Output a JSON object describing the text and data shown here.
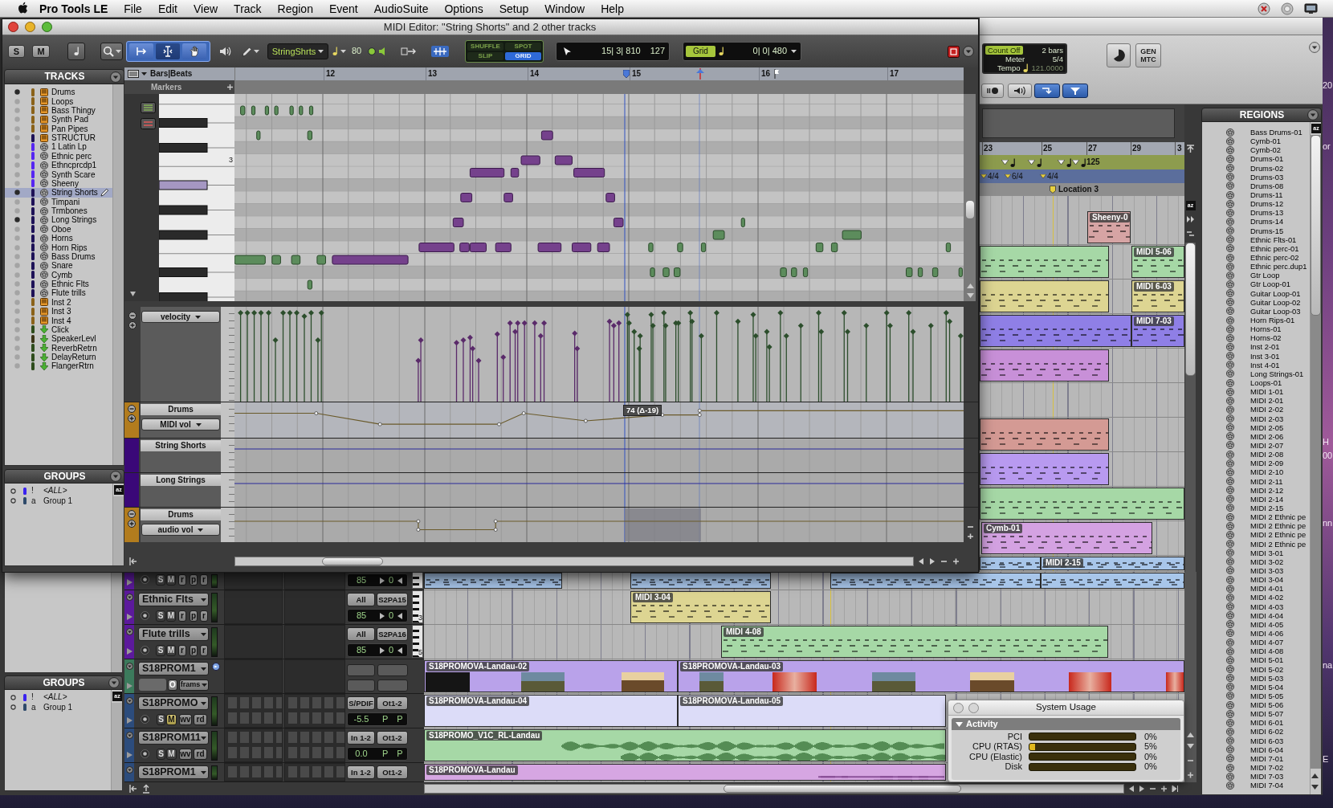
{
  "menu_bar": {
    "app": "Pro Tools LE",
    "items": [
      "File",
      "Edit",
      "View",
      "Track",
      "Region",
      "Event",
      "AudioSuite",
      "Options",
      "Setup",
      "Window",
      "Help"
    ]
  },
  "midi_editor": {
    "title": "MIDI Editor: \"String Shorts\" and 2 other tracks",
    "toolbar": {
      "solo": "S",
      "mute": "M",
      "track": "StringShrts",
      "velocity": "80",
      "modes": [
        {
          "label": "SHUFFLE",
          "selected": false
        },
        {
          "label": "SPOT",
          "selected": false
        },
        {
          "label": "SLIP",
          "selected": false
        },
        {
          "label": "GRID",
          "selected": true
        }
      ],
      "counter": "15| 3| 810",
      "counter_value": "127",
      "grid": "Grid",
      "grid_value": "0| 0| 480"
    },
    "ruler": {
      "label": "Bars|Beats",
      "markers": "Markers",
      "bars": [
        "12",
        "13",
        "14",
        "15",
        "16",
        "17"
      ]
    },
    "tracks": {
      "title": "TRACKS",
      "items": [
        {
          "name": "Drums",
          "kind": "instrument",
          "shown": true,
          "selected": false,
          "color": "#8a621a"
        },
        {
          "name": "Loops",
          "kind": "instrument",
          "shown": false,
          "selected": false,
          "color": "#8a621a"
        },
        {
          "name": "Bass Thingy",
          "kind": "instrument",
          "shown": false,
          "selected": false,
          "color": "#8a621a"
        },
        {
          "name": "Synth Pad",
          "kind": "instrument",
          "shown": false,
          "selected": false,
          "color": "#8a621a"
        },
        {
          "name": "Pan Pipes",
          "kind": "instrument",
          "shown": false,
          "selected": false,
          "color": "#8a621a"
        },
        {
          "name": "STRUCTUR",
          "kind": "instrument",
          "shown": false,
          "selected": false,
          "color": "#1e1258"
        },
        {
          "name": "1 Latin Lp",
          "kind": "midi",
          "shown": false,
          "selected": false,
          "color": "#5626f2"
        },
        {
          "name": "Ethnic perc",
          "kind": "midi",
          "shown": false,
          "selected": false,
          "color": "#5626f2"
        },
        {
          "name": "Ethncprcdp1",
          "kind": "midi",
          "shown": false,
          "selected": false,
          "color": "#5626f2"
        },
        {
          "name": "Synth Scare",
          "kind": "midi",
          "shown": false,
          "selected": false,
          "color": "#5626f2"
        },
        {
          "name": "Sheeny",
          "kind": "midi",
          "shown": false,
          "selected": false,
          "color": "#5626f2"
        },
        {
          "name": "String Shorts",
          "kind": "midi",
          "shown": true,
          "selected": true,
          "color": "#1e1258"
        },
        {
          "name": "Timpani",
          "kind": "midi",
          "shown": false,
          "selected": false,
          "color": "#1e1258"
        },
        {
          "name": "Trmbones",
          "kind": "midi",
          "shown": false,
          "selected": false,
          "color": "#1e1258"
        },
        {
          "name": "Long Strings",
          "kind": "midi",
          "shown": true,
          "selected": false,
          "color": "#1e1258"
        },
        {
          "name": "Oboe",
          "kind": "midi",
          "shown": false,
          "selected": false,
          "color": "#1e1258"
        },
        {
          "name": "Horns",
          "kind": "midi",
          "shown": false,
          "selected": false,
          "color": "#1e1258"
        },
        {
          "name": "Horn Rips",
          "kind": "midi",
          "shown": false,
          "selected": false,
          "color": "#1e1258"
        },
        {
          "name": "Bass Drums",
          "kind": "midi",
          "shown": false,
          "selected": false,
          "color": "#1e1258"
        },
        {
          "name": "Snare",
          "kind": "midi",
          "shown": false,
          "selected": false,
          "color": "#1e1258"
        },
        {
          "name": "Cymb",
          "kind": "midi",
          "shown": false,
          "selected": false,
          "color": "#1e1258"
        },
        {
          "name": "Ethnic Flts",
          "kind": "midi",
          "shown": false,
          "selected": false,
          "color": "#1e1258"
        },
        {
          "name": "Flute trills",
          "kind": "midi",
          "shown": false,
          "selected": false,
          "color": "#1e1258"
        },
        {
          "name": "Inst 2",
          "kind": "instrument",
          "shown": false,
          "selected": false,
          "color": "#8a621a"
        },
        {
          "name": "Inst 3",
          "kind": "instrument",
          "shown": false,
          "selected": false,
          "color": "#8a621a"
        },
        {
          "name": "Inst 4",
          "kind": "instrument",
          "shown": false,
          "selected": false,
          "color": "#8a621a"
        },
        {
          "name": "Click",
          "kind": "aux",
          "shown": false,
          "selected": false,
          "color": "#2e4c1c"
        },
        {
          "name": "SpeakerLevl",
          "kind": "aux",
          "shown": false,
          "selected": false,
          "color": "#3c3416"
        },
        {
          "name": "ReverbRetrn",
          "kind": "aux",
          "shown": false,
          "selected": false,
          "color": "#2e4c1c"
        },
        {
          "name": "DelayReturn",
          "kind": "aux",
          "shown": false,
          "selected": false,
          "color": "#2e4c1c"
        },
        {
          "name": "FlangerRtrn",
          "kind": "aux",
          "shown": false,
          "selected": false,
          "color": "#2e4c1c"
        }
      ]
    },
    "groups": {
      "title": "GROUPS",
      "sort": "az",
      "items": [
        {
          "flag": "!",
          "name": "<ALL>",
          "kind": "all",
          "color": "#3a22f0"
        },
        {
          "flag": "a",
          "name": "Group 1",
          "kind": "group",
          "color": "#2e4a6a"
        }
      ]
    },
    "key_label": "3",
    "velocity_control": "velocity",
    "lanes": [
      {
        "track": "Drums",
        "control": "MIDI vol",
        "color": "#b27c1e"
      },
      {
        "track": "String Shorts",
        "color": "#3a0878"
      },
      {
        "track": "Long Strings",
        "color": "#3a0878"
      },
      {
        "track": "Drums",
        "control": "audio vol",
        "color": "#b27c1e"
      }
    ],
    "tooltip": "74 (Δ-19)"
  },
  "edit_window": {
    "counters": {
      "count_off": "Count Off",
      "bars": "2 bars",
      "meter_label": "Meter",
      "meter": "5/4",
      "tempo_label": "Tempo",
      "tempo": "121.0000",
      "sync": [
        "GEN",
        "MTC"
      ]
    },
    "ruler": {
      "bars": [
        "23",
        "25",
        "27",
        "29",
        "3"
      ],
      "tempo": "125",
      "meters": [
        "4/4",
        "6/4",
        "4/4"
      ],
      "marker": "Location 3"
    },
    "sort": "az",
    "upper_lanes": [
      {
        "regions": [
          {
            "label": "Sheeny-0",
            "color": "#d6a4a4"
          }
        ]
      },
      {
        "regions": [
          {
            "color": "#a6d8a6"
          },
          {
            "label": "MIDI 5-06",
            "color": "#a6d8a6"
          }
        ]
      },
      {
        "regions": [
          {
            "color": "#ddd592"
          },
          {
            "label": "MIDI 6-03",
            "color": "#ddd592"
          }
        ]
      },
      {
        "regions": [
          {
            "color": "#8f7fe6"
          },
          {
            "label": "MIDI 7-03",
            "color": "#8f7fe6"
          }
        ]
      },
      {
        "regions": [
          {
            "color": "#c890d8"
          }
        ]
      },
      {
        "regions": [
          {
            "color": "#d49a94"
          }
        ]
      },
      {
        "regions": [
          {
            "color": "#b89af0"
          }
        ]
      },
      {
        "regions": [
          {
            "color": "#a6d8a6"
          }
        ]
      },
      {
        "regions": [
          {
            "label": "Cymb-01",
            "color": "#d4a2e2"
          }
        ]
      },
      {
        "regions": [
          {
            "color": "#a8c6ea"
          },
          {
            "label": "MIDI 2-15",
            "color": "#a8c6ea"
          }
        ]
      }
    ],
    "tracks": [
      {
        "kind": "midi",
        "color": "#5c1a9c",
        "buttons": [
          "S",
          "M",
          "r",
          "p",
          "r"
        ],
        "muted": false,
        "volume": "85",
        "pan": "0",
        "regions": [
          {
            "color": "#a8c6ea"
          },
          {
            "color": "#a8c6ea"
          },
          {
            "color": "#a8c6ea"
          },
          {
            "color": "#a8c6ea"
          }
        ]
      },
      {
        "kind": "midi",
        "name": "Ethnic Flts",
        "color": "#5c1a9c",
        "io": [
          "All",
          "S2PA15"
        ],
        "buttons": [
          "S",
          "M",
          "r",
          "p",
          "r"
        ],
        "muted": false,
        "volume": "85",
        "pan": "0",
        "keyboard_label": "3",
        "regions": [
          {
            "label": "MIDI 3-04",
            "color": "#ddd592"
          }
        ]
      },
      {
        "kind": "midi",
        "name": "Flute trills",
        "color": "#5c1a9c",
        "io": [
          "All",
          "S2PA16"
        ],
        "buttons": [
          "S",
          "M",
          "r",
          "p",
          "r"
        ],
        "muted": false,
        "volume": "85",
        "pan": "0",
        "keyboard_label": "5",
        "regions": [
          {
            "label": "MIDI 4-08",
            "color": "#a6d8a6"
          }
        ]
      },
      {
        "kind": "video",
        "name": "S18PROM1",
        "color": "#3c7a5c",
        "mode": "O",
        "format": "frams",
        "regions": [
          {
            "label": "S18PROMOVA-Landau-02",
            "color": "#b9a2ea"
          },
          {
            "label": "S18PROMOVA-Landau-03",
            "color": "#b9a2ea"
          }
        ]
      },
      {
        "kind": "audio",
        "name": "S18PROMO",
        "color": "#2c4c7c",
        "io": [
          "S/PDIF",
          "Ot1-2"
        ],
        "buttons": [
          "S",
          "M",
          "wv",
          "rd"
        ],
        "muted": true,
        "volume": "-5.5",
        "pan": [
          "P",
          "P"
        ],
        "regions": [
          {
            "label": "S18PROMOVA-Landau-04",
            "color": "#dcdcf8"
          },
          {
            "label": "S18PROMOVA-Landau-05",
            "color": "#dcdcf8"
          }
        ]
      },
      {
        "kind": "audio",
        "name": "S18PROM11",
        "color": "#2c4c7c",
        "io": [
          "In 1-2",
          "Ot1-2"
        ],
        "buttons": [
          "S",
          "M",
          "wv",
          "rd"
        ],
        "muted": false,
        "volume": "0.0",
        "pan": [
          "P",
          "P"
        ],
        "regions": [
          {
            "label": "S18PROMO_V1C_RL-Landau",
            "color": "#a6d8a6"
          }
        ]
      },
      {
        "kind": "audio",
        "name": "S18PROM1",
        "color": "#2c4c7c",
        "io": [
          "In 1-2",
          "Ot1-2"
        ],
        "regions": [
          {
            "label": "S18PROMOVA-Landau",
            "color": "#d6a6e2"
          }
        ]
      }
    ],
    "groups": {
      "title": "GROUPS",
      "sort": "az",
      "items": [
        {
          "flag": "!",
          "name": "<ALL>",
          "kind": "all",
          "color": "#3a22f0"
        },
        {
          "flag": "a",
          "name": "Group 1",
          "kind": "group",
          "color": "#2e4a6a"
        }
      ]
    },
    "regions": {
      "title": "REGIONS",
      "sort": "az",
      "items": [
        "Bass Drums-01",
        "Cymb-01",
        "Cymb-02",
        "Drums-01",
        "Drums-02",
        "Drums-03",
        "Drums-08",
        "Drums-11",
        "Drums-12",
        "Drums-13",
        "Drums-14",
        "Drums-15",
        "Ethnic Flts-01",
        "Ethnic perc-01",
        "Ethnic perc-02",
        "Ethnic perc.dup1",
        "Gtr Loop",
        "Gtr Loop-01",
        "Guitar Loop-01",
        "Guitar Loop-02",
        "Guitar Loop-03",
        "Horn Rips-01",
        "Horns-01",
        "Horns-02",
        "Inst 2-01",
        "Inst 3-01",
        "Inst 4-01",
        "Long Strings-01",
        "Loops-01",
        "MIDI 1-01",
        "MIDI 2-01",
        "MIDI 2-02",
        "MIDI 2-03",
        "MIDI 2-05",
        "MIDI 2-06",
        "MIDI 2-07",
        "MIDI 2-08",
        "MIDI 2-09",
        "MIDI 2-10",
        "MIDI 2-11",
        "MIDI 2-12",
        "MIDI 2-14",
        "MIDI 2-15",
        "MIDI 2 Ethnic pe",
        "MIDI 2 Ethnic pe",
        "MIDI 2 Ethnic pe",
        "MIDI 2 Ethnic pe",
        "MIDI 3-01",
        "MIDI 3-02",
        "MIDI 3-03",
        "MIDI 3-04",
        "MIDI 4-01",
        "MIDI 4-02",
        "MIDI 4-03",
        "MIDI 4-04",
        "MIDI 4-05",
        "MIDI 4-06",
        "MIDI 4-07",
        "MIDI 4-08",
        "MIDI 5-01",
        "MIDI 5-02",
        "MIDI 5-03",
        "MIDI 5-04",
        "MIDI 5-05",
        "MIDI 5-06",
        "MIDI 5-07",
        "MIDI 6-01",
        "MIDI 6-02",
        "MIDI 6-03",
        "MIDI 6-04",
        "MIDI 7-01",
        "MIDI 7-02",
        "MIDI 7-03",
        "MIDI 7-04"
      ]
    }
  },
  "system_usage": {
    "title": "System Usage",
    "section": "Activity",
    "meters": [
      {
        "label": "PCI",
        "level": 0,
        "reading": "0%"
      },
      {
        "label": "CPU (RTAS)",
        "level": 0.05,
        "reading": "5%"
      },
      {
        "label": "CPU (Elastic)",
        "level": 0,
        "reading": "0%"
      },
      {
        "label": "Disk",
        "level": 0,
        "reading": "0%"
      }
    ]
  },
  "desktop_fragments": [
    "20",
    "or",
    "H",
    "00",
    "nn",
    "na",
    "E"
  ]
}
